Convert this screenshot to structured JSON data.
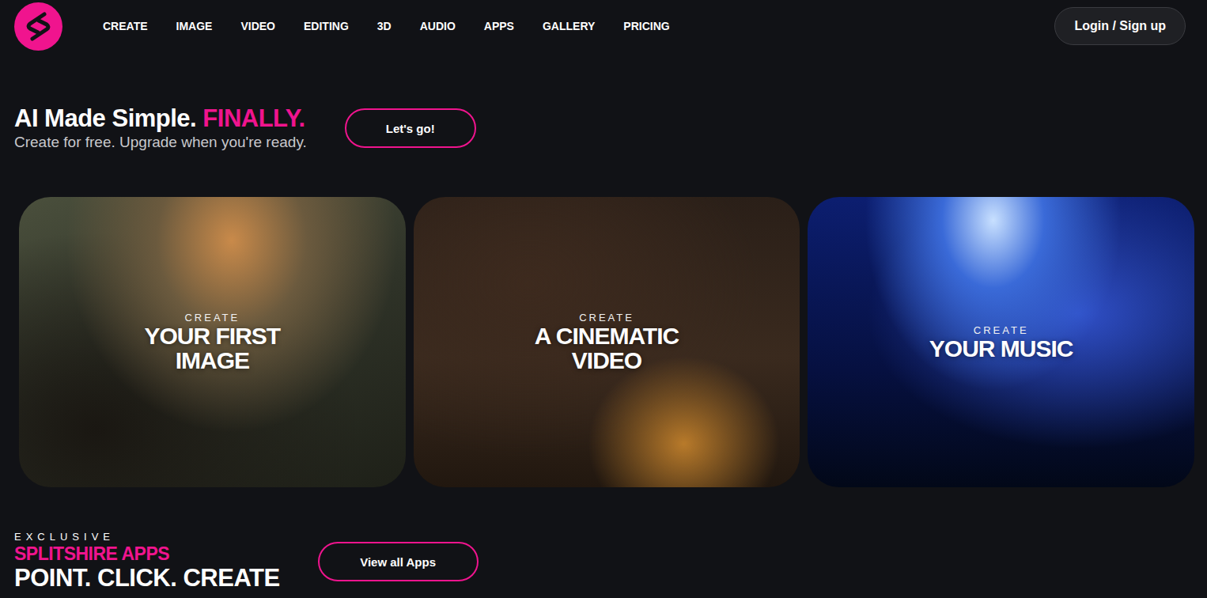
{
  "nav": {
    "items": [
      "CREATE",
      "IMAGE",
      "VIDEO",
      "EDITING",
      "3D",
      "AUDIO",
      "APPS",
      "GALLERY",
      "PRICING"
    ],
    "login": "Login / Sign up"
  },
  "hero": {
    "title": "AI Made Simple.",
    "highlight": "FINALLY.",
    "subtitle": "Create for free. Upgrade when you're ready.",
    "cta": "Let's go!"
  },
  "cards": [
    {
      "eyebrow": "CREATE",
      "title": "YOUR FIRST IMAGE"
    },
    {
      "eyebrow": "CREATE",
      "title": "A CINEMATIC VIDEO"
    },
    {
      "eyebrow": "CREATE",
      "title": "YOUR MUSIC"
    }
  ],
  "apps": {
    "eyebrow": "EXCLUSIVE",
    "brand": "SPLITSHIRE APPS",
    "tagline": "POINT. CLICK. CREATE",
    "button": "View all Apps"
  }
}
